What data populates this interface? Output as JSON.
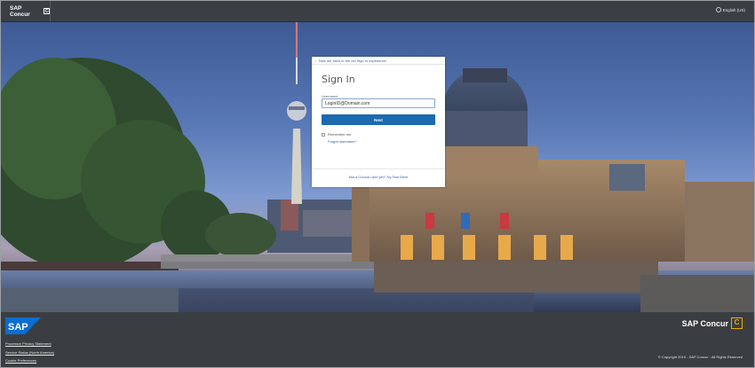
{
  "header": {
    "brand": "SAP Concur",
    "brand_mark": "C",
    "language": "English (US)",
    "language_icon": "globe-icon"
  },
  "signin": {
    "back_link": "Take me back to the old Sign In experience",
    "title": "Sign In",
    "username_label": "Username",
    "username_value": "LoginID@Domain.com",
    "next_label": "Next",
    "remember_label": "Remember me",
    "forgot_label": "Forgot username?",
    "trial_label": "Not a Concur user yet? Try Test Drive"
  },
  "footer": {
    "sap_logo_text": "SAP",
    "links": [
      "Processor Privacy Statement",
      "Service Status (North America)",
      "Cookie Preferences"
    ],
    "concur_logo": "SAP Concur",
    "concur_mark": "C",
    "copyright": "© Copyright 2019 - SAP Concur - All Rights Reserved"
  },
  "colors": {
    "header_bg": "#3b3f44",
    "primary_button": "#1b6ab0",
    "concur_accent": "#f0ab00",
    "sap_blue": "#0a6ed1"
  }
}
